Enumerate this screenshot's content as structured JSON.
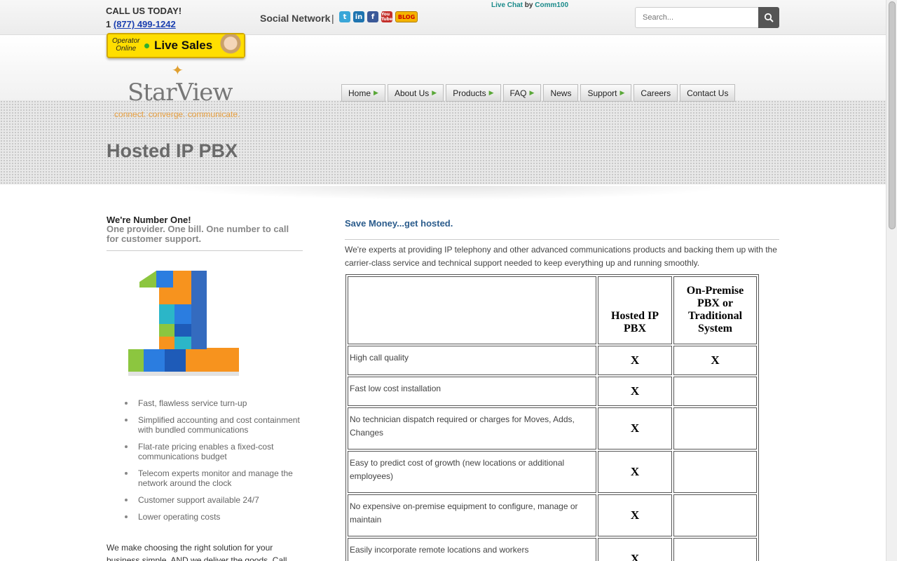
{
  "header": {
    "call_today": "CALL US TODAY!",
    "phone_prefix": "1",
    "phone": "(877) 499-1242",
    "social_label": "Social Network",
    "social_sep": "|",
    "social_icons": [
      "twitter-icon",
      "linkedin-icon",
      "facebook-icon",
      "youtube-icon",
      "blog-icon"
    ],
    "social_glyphs": {
      "twitter": "t",
      "linkedin": "in",
      "facebook": "f",
      "youtube": "You Tube",
      "blog": "BLOG"
    },
    "live_chat": "Live Chat",
    "live_chat_by": "by",
    "live_chat_vendor": "Comm100",
    "search_placeholder": "Search..."
  },
  "live_sales": {
    "operator_line1": "Operator",
    "operator_line2": "Online",
    "label": "Live Sales"
  },
  "logo": {
    "name": "StarView",
    "tagline": "connect. converge. communicate."
  },
  "nav": [
    {
      "label": "Home",
      "has_arrow": true
    },
    {
      "label": "About Us",
      "has_arrow": true
    },
    {
      "label": "Products",
      "has_arrow": true
    },
    {
      "label": "FAQ",
      "has_arrow": true
    },
    {
      "label": "News",
      "has_arrow": false
    },
    {
      "label": "Support",
      "has_arrow": true
    },
    {
      "label": "Careers",
      "has_arrow": false
    },
    {
      "label": "Contact Us",
      "has_arrow": false
    }
  ],
  "page_title": "Hosted IP PBX",
  "left": {
    "heading": "We're Number One!",
    "subheading": "One provider. One bill. One number to call for customer support.",
    "benefits": [
      "Fast, flawless service turn-up",
      "Simplified accounting and cost containment with bundled communications",
      "Flat-rate pricing enables a fixed-cost communications budget",
      "Telecom experts monitor and manage the network around the clock",
      "Customer support available 24/7",
      "Lower operating costs"
    ],
    "paragraph": "We make choosing the right solution for your business simple. AND we deliver the goods. Call"
  },
  "right": {
    "title": "Save Money...get hosted.",
    "intro": "We're experts at providing IP telephony and other advanced communications products and backing them up with the carrier-class service and technical support needed to keep everything up and running smoothly.",
    "table": {
      "headers": [
        "",
        "Hosted IP PBX",
        "On-Premise PBX or Traditional System"
      ],
      "rows": [
        {
          "feature": "High call quality",
          "hosted": "X",
          "onprem": "X"
        },
        {
          "feature": "Fast low cost installation",
          "hosted": "X",
          "onprem": ""
        },
        {
          "feature": "No technician dispatch required or charges for Moves, Adds, Changes",
          "hosted": "X",
          "onprem": ""
        },
        {
          "feature": "Easy to predict cost of growth (new locations or additional employees)",
          "hosted": "X",
          "onprem": ""
        },
        {
          "feature": "No expensive on-premise equipment to configure, manage or maintain",
          "hosted": "X",
          "onprem": ""
        },
        {
          "feature": "Easily incorporate remote locations and workers",
          "hosted": "X",
          "onprem": ""
        }
      ]
    }
  },
  "colors": {
    "accent_blue": "#2b5c8c",
    "link_blue": "#1a3fb0",
    "live_sales_yellow": "#ffde00",
    "nav_arrow_green": "#5aa838",
    "tagline_orange": "#e8a040"
  }
}
